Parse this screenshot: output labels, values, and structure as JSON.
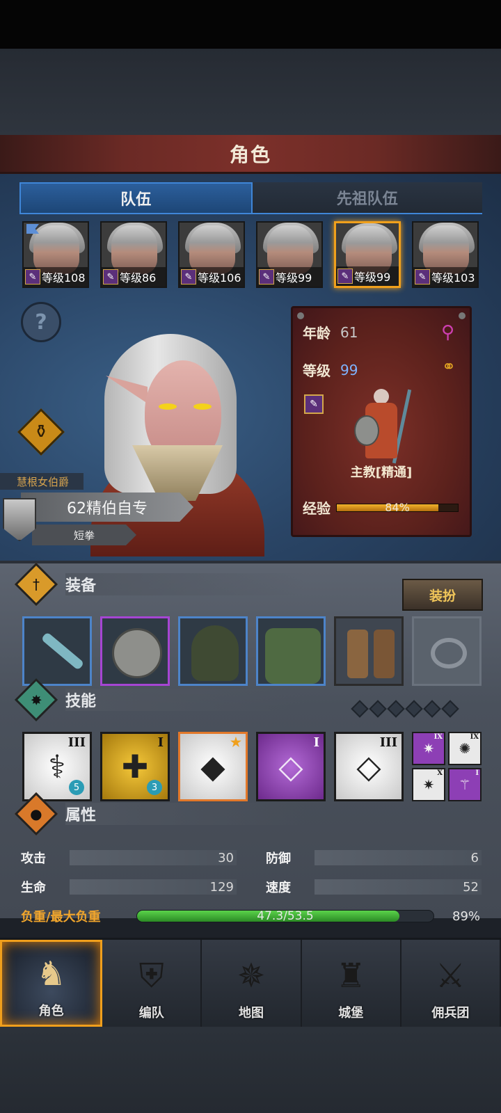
{
  "header": {
    "title": "角色"
  },
  "tabs": [
    {
      "label": "队伍",
      "active": true
    },
    {
      "label": "先祖队伍",
      "active": false
    }
  ],
  "roster": [
    {
      "level": "等级108",
      "flag": true,
      "selected": false
    },
    {
      "level": "等级86",
      "flag": false,
      "selected": false
    },
    {
      "level": "等级106",
      "flag": false,
      "selected": false
    },
    {
      "level": "等级99",
      "flag": false,
      "selected": false
    },
    {
      "level": "等级99",
      "flag": false,
      "selected": true
    },
    {
      "level": "等级103",
      "flag": false,
      "selected": false
    }
  ],
  "character": {
    "title": "慧根女伯爵",
    "name": "62精伯自专",
    "weapon": "短拳",
    "age_label": "年龄",
    "age": "61",
    "level_label": "等级",
    "level": "99",
    "class_name": "主教[精通]",
    "exp_label": "经验",
    "exp_text": "84%",
    "exp_value": 0.84
  },
  "equipment": {
    "title": "装备",
    "dress_button": "装扮",
    "slots": [
      {
        "icon": "mace-icon",
        "rarity": "blue"
      },
      {
        "icon": "shield-icon",
        "rarity": "purple"
      },
      {
        "icon": "hood-icon",
        "rarity": "blue"
      },
      {
        "icon": "tunic-icon",
        "rarity": "blue"
      },
      {
        "icon": "boots-icon",
        "rarity": "gray"
      },
      {
        "icon": "ring-icon",
        "rarity": "empty"
      }
    ]
  },
  "skills": {
    "title": "技能",
    "slots": [
      {
        "icon": "spear-strike-icon",
        "rank": "III",
        "gem": "5",
        "style": "white"
      },
      {
        "icon": "holy-shield-icon",
        "rank": "I",
        "gem": "3",
        "style": "gold"
      },
      {
        "icon": "crystal-prayer-icon",
        "rank": "",
        "gem": "",
        "style": "orange"
      },
      {
        "icon": "crystal-hand-icon",
        "rank": "I",
        "gem": "",
        "style": "purple"
      },
      {
        "icon": "crystal-hand-icon",
        "rank": "III",
        "gem": "",
        "style": "white"
      }
    ],
    "mini": [
      {
        "icon": "burst-icon",
        "rank": "IX",
        "style": "purple"
      },
      {
        "icon": "sparkle-burst-icon",
        "rank": "IX",
        "style": "white"
      },
      {
        "icon": "burst-icon",
        "rank": "X",
        "style": "white"
      },
      {
        "icon": "wand-icon",
        "rank": "I",
        "style": "purple"
      }
    ]
  },
  "attributes": {
    "title": "属性",
    "attack_label": "攻击",
    "attack": "30",
    "defense_label": "防御",
    "defense": "6",
    "hp_label": "生命",
    "hp": "129",
    "speed_label": "速度",
    "speed": "52",
    "load_label": "负重/最大负重",
    "load_text": "47.3/53.5",
    "load_pct": "89%",
    "load_value": 0.884
  },
  "nav": [
    {
      "label": "角色",
      "icon": "knight-icon",
      "active": true
    },
    {
      "label": "编队",
      "icon": "formation-icon",
      "active": false
    },
    {
      "label": "地图",
      "icon": "compass-map-icon",
      "active": false
    },
    {
      "label": "城堡",
      "icon": "castle-icon",
      "active": false
    },
    {
      "label": "佣兵团",
      "icon": "mercenary-icon",
      "active": false
    }
  ],
  "colors": {
    "active_tab": "#2c5f9c",
    "selection": "#f0a01c",
    "exp_fill": "#f2b22b",
    "load_fill": "#5ad34a",
    "load_label": "#f2a62c"
  }
}
